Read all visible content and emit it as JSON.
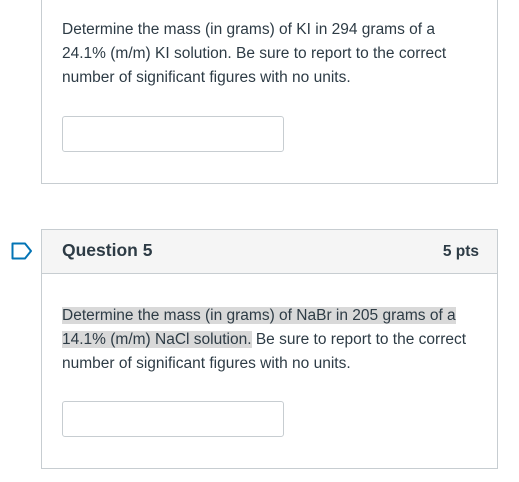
{
  "question4": {
    "text": "Determine the mass (in grams) of KI in 294 grams of a 24.1% (m/m) KI solution.  Be sure to report to the correct number of significant figures with no units.",
    "answer_value": ""
  },
  "question5": {
    "title": "Question 5",
    "points": "5 pts",
    "text_highlighted": "Determine the mass (in grams) of NaBr in 205 grams of a 14.1% (m/m) NaCl solution.",
    "text_rest": "  Be sure to report to the correct number of significant figures with no units.",
    "answer_value": ""
  },
  "colors": {
    "border": "#c7cdd1",
    "header_bg": "#f5f5f5",
    "flag": "#0374b5",
    "highlight": "#d9d9d9",
    "text": "#2d3b45"
  },
  "icons": {
    "flag": "bookmark-flag-icon"
  }
}
